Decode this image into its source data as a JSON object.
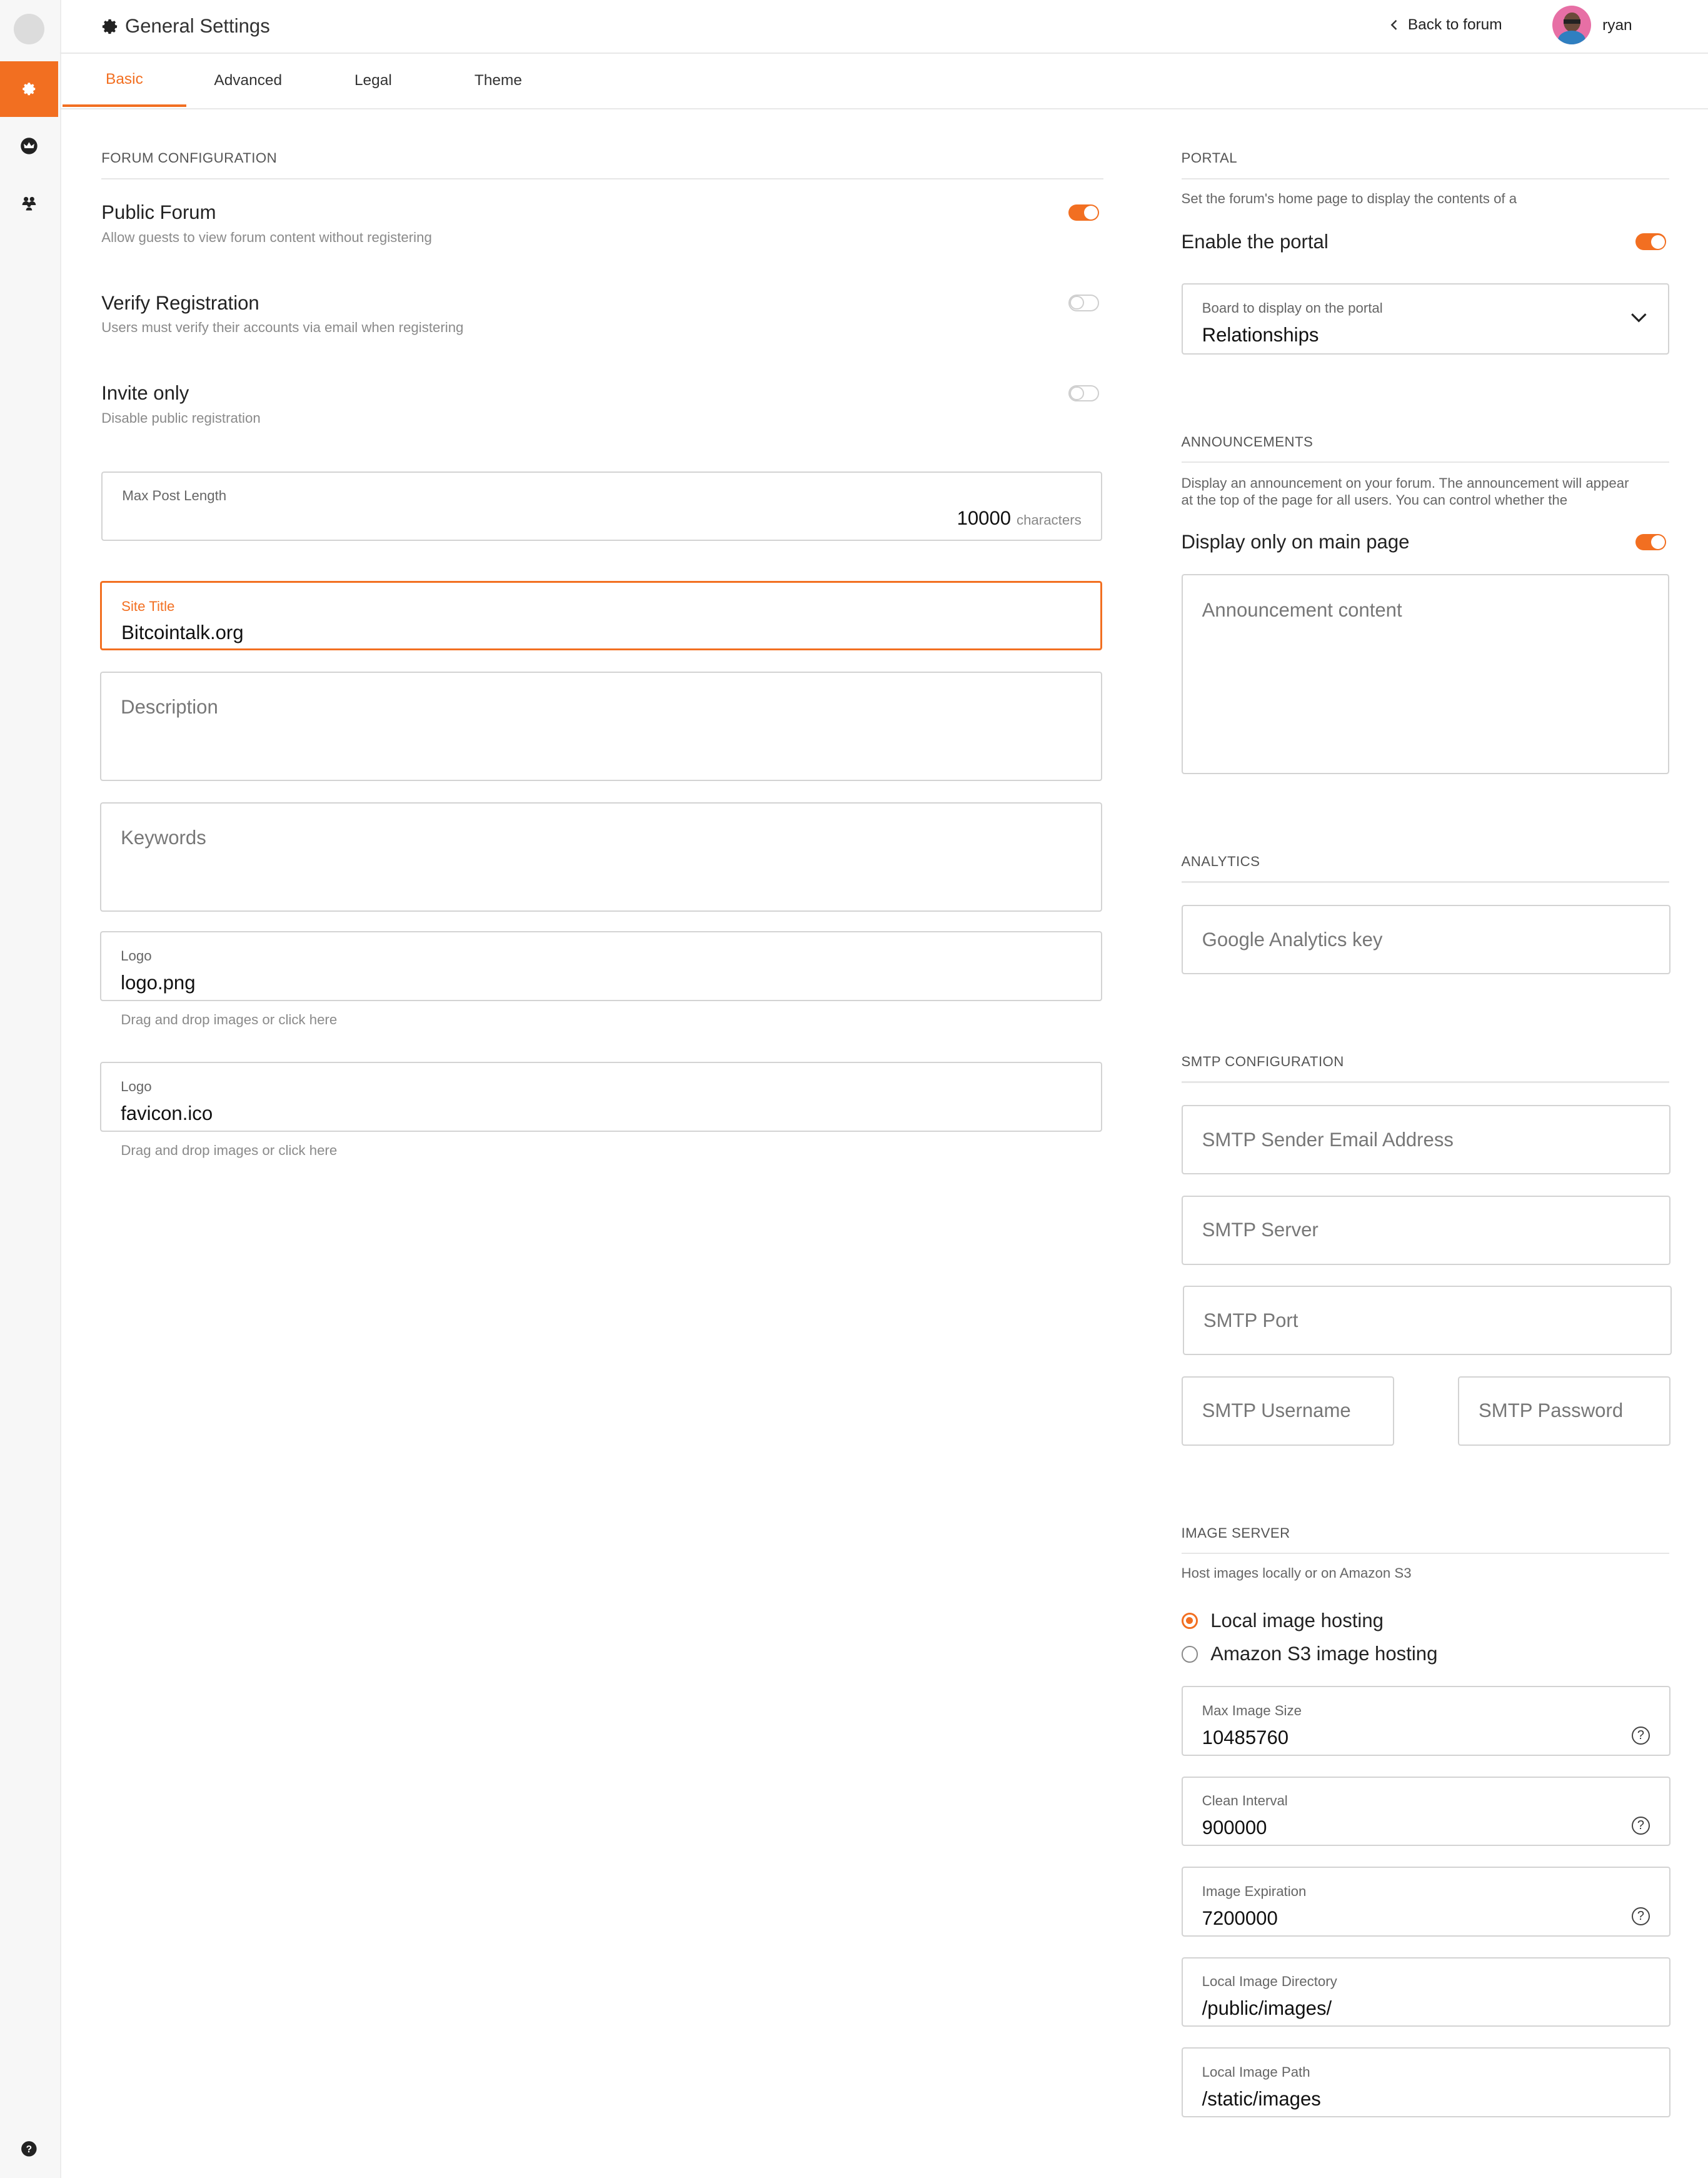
{
  "header": {
    "title": "General Settings",
    "back_label": "Back to forum",
    "user_name": "ryan"
  },
  "tabs": [
    "Basic",
    "Advanced",
    "Legal",
    "Theme"
  ],
  "sidebar": {
    "icons": [
      "settings-icon",
      "crown-icon",
      "group-icon",
      "help-icon"
    ]
  },
  "forum_config": {
    "section_title": "FORUM CONFIGURATION",
    "toggles": [
      {
        "label": "Public Forum",
        "help": "Allow guests to view forum content without registering",
        "on": true
      },
      {
        "label": "Verify Registration",
        "help": "Users must verify their accounts via email when registering",
        "on": false
      },
      {
        "label": "Invite only",
        "help": "Disable public registration",
        "on": false
      }
    ],
    "max_post": {
      "label": "Max Post Length",
      "value": "10000",
      "unit": "characters"
    },
    "site_title": {
      "label": "Site Title",
      "value": "Bitcointalk.org"
    },
    "description": {
      "placeholder": "Description"
    },
    "keywords": {
      "placeholder": "Keywords"
    },
    "logo": {
      "label": "Logo",
      "value": "logo.png",
      "help": "Drag and drop images or click here"
    },
    "favicon": {
      "label": "Logo",
      "value": "favicon.ico",
      "help": "Drag and drop images or click here"
    }
  },
  "portal": {
    "section_title": "PORTAL",
    "description": "Set the forum's home page to display the contents of a",
    "enable_label": "Enable the portal",
    "enabled": true,
    "board_label": "Board to display on the portal",
    "board_value": "Relationships"
  },
  "announcements": {
    "section_title": "ANNOUNCEMENTS",
    "description_line1": "Display an announcement on your forum. The announcement will appear",
    "description_line2": "at the top of the page for all users. You can control whether the",
    "main_only_label": "Display only on main page",
    "main_only": true,
    "content_placeholder": "Announcement content"
  },
  "analytics": {
    "section_title": "ANALYTICS",
    "key_placeholder": "Google Analytics key"
  },
  "smtp": {
    "section_title": "SMTP CONFIGURATION",
    "sender_placeholder": "SMTP Sender Email Address",
    "server_placeholder": "SMTP Server",
    "port_placeholder": "SMTP Port",
    "username_placeholder": "SMTP Username",
    "password_placeholder": "SMTP Password"
  },
  "image_server": {
    "section_title": "IMAGE SERVER",
    "description": "Host images locally or on Amazon S3",
    "options": [
      {
        "label": "Local image hosting",
        "selected": true
      },
      {
        "label": "Amazon S3 image hosting",
        "selected": false
      }
    ],
    "max_size": {
      "label": "Max Image Size",
      "value": "10485760"
    },
    "clean_interval": {
      "label": "Clean Interval",
      "value": "900000"
    },
    "expiration": {
      "label": "Image Expiration",
      "value": "7200000"
    },
    "local_dir": {
      "label": "Local Image Directory",
      "value": "/public/images/"
    },
    "local_path": {
      "label": "Local Image Path",
      "value": "/static/images"
    }
  },
  "colors": {
    "accent": "#f26f21",
    "border": "#d3d3d3"
  }
}
